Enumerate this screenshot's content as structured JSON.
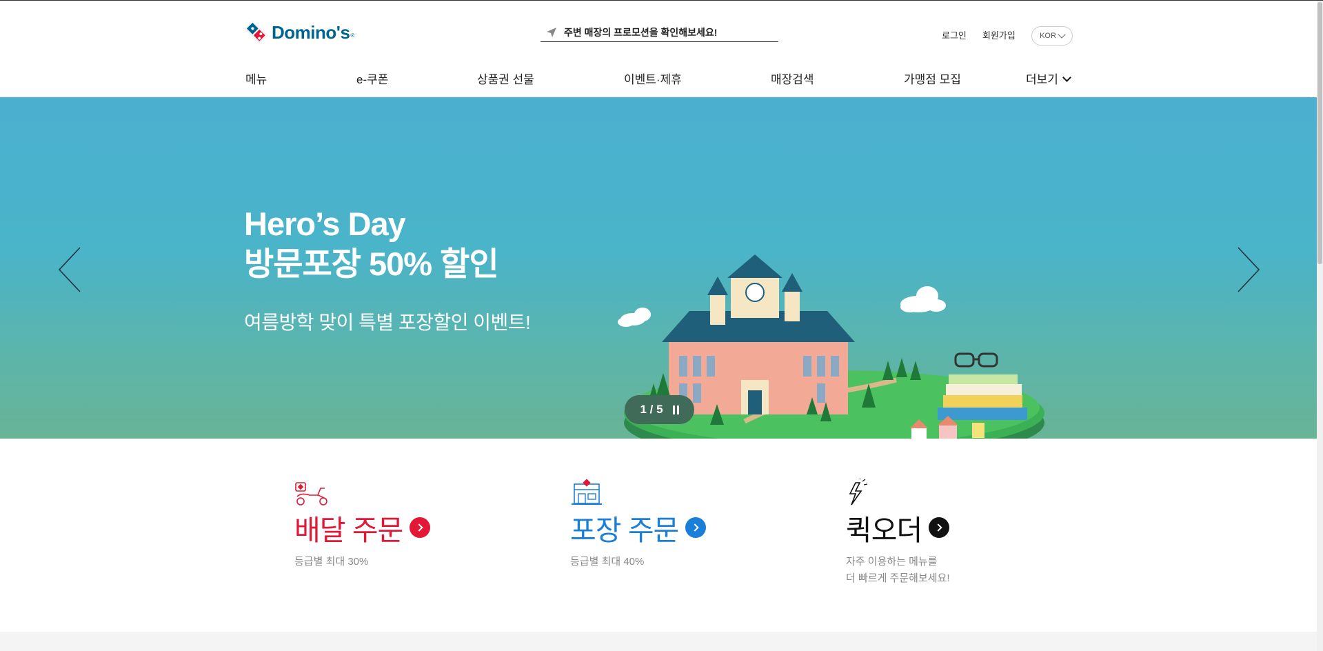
{
  "header": {
    "logo_text": "Domino's",
    "logo_reg": "®",
    "promo_search": "주변 매장의 프로모션을 확인해보세요!",
    "login": "로그인",
    "join": "회원가입",
    "language": "KOR"
  },
  "gnb": [
    {
      "label": "메뉴"
    },
    {
      "label": "e-쿠폰"
    },
    {
      "label": "상품권 선물"
    },
    {
      "label": "이벤트·제휴"
    },
    {
      "label": "매장검색"
    },
    {
      "label": "가맹점 모집"
    },
    {
      "label": "더보기"
    }
  ],
  "hero": {
    "title_line1": "Hero’s Day",
    "title_line2": "방문포장 50% 할인",
    "subtitle": "여름방학 맞이 특별 포장할인 이벤트!",
    "pager": "1 / 5",
    "current_slide": 1,
    "total_slides": 5
  },
  "order": {
    "delivery": {
      "title": "배달 주문",
      "desc": "등급별 최대 30%",
      "color": "#e31837",
      "icon": "scooter-icon"
    },
    "takeout": {
      "title": "포장 주문",
      "desc": "등급별 최대 40%",
      "color": "#1a7fd8",
      "icon": "store-icon"
    },
    "quick": {
      "title": "퀵오더",
      "desc_line1": "자주 이용하는 메뉴를",
      "desc_line2": "더 빠르게 주문해보세요!",
      "color": "#111111",
      "icon": "lightning-icon"
    }
  },
  "colors": {
    "brand_blue": "#006491",
    "brand_red": "#e31837"
  }
}
